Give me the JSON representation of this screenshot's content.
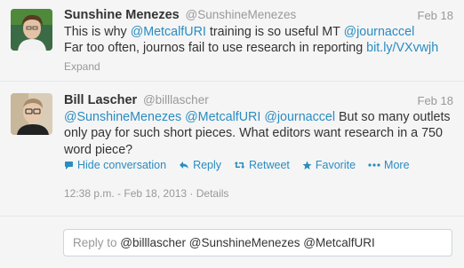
{
  "tweet1": {
    "fullname": "Sunshine Menezes",
    "username": "@SunshineMenezes",
    "time": "Feb 18",
    "line1_text": "This is why ",
    "line1_mention": "@MetcalfURI",
    "line1_text2": " training is so useful MT ",
    "line1_mention2": "@journaccel",
    "line2_text": "Far too often, journos fail to use research in reporting ",
    "line2_link": "bit.ly/VXvwjh",
    "expand": "Expand"
  },
  "tweet2": {
    "fullname": "Bill Lascher",
    "username": "@billlascher",
    "time": "Feb 18",
    "mention1": "@SunshineMenezes",
    "mention2": "@MetcalfURI",
    "mention3": "@journaccel",
    "body": " But so many outlets only pay for such short pieces. What editors want research in a 750 word piece?",
    "actions": {
      "hide": "Hide conversation",
      "reply": "Reply",
      "retweet": "Retweet",
      "favorite": "Favorite",
      "more": "More"
    },
    "meta": "12:38 p.m. - Feb 18, 2013 · Details"
  },
  "reply": {
    "prefix": "Reply to ",
    "mentions": "@billlascher @SunshineMenezes @MetcalfURI"
  },
  "colors": {
    "link": "#2a8cc1",
    "muted": "#999999",
    "background": "#f5f5f5"
  }
}
